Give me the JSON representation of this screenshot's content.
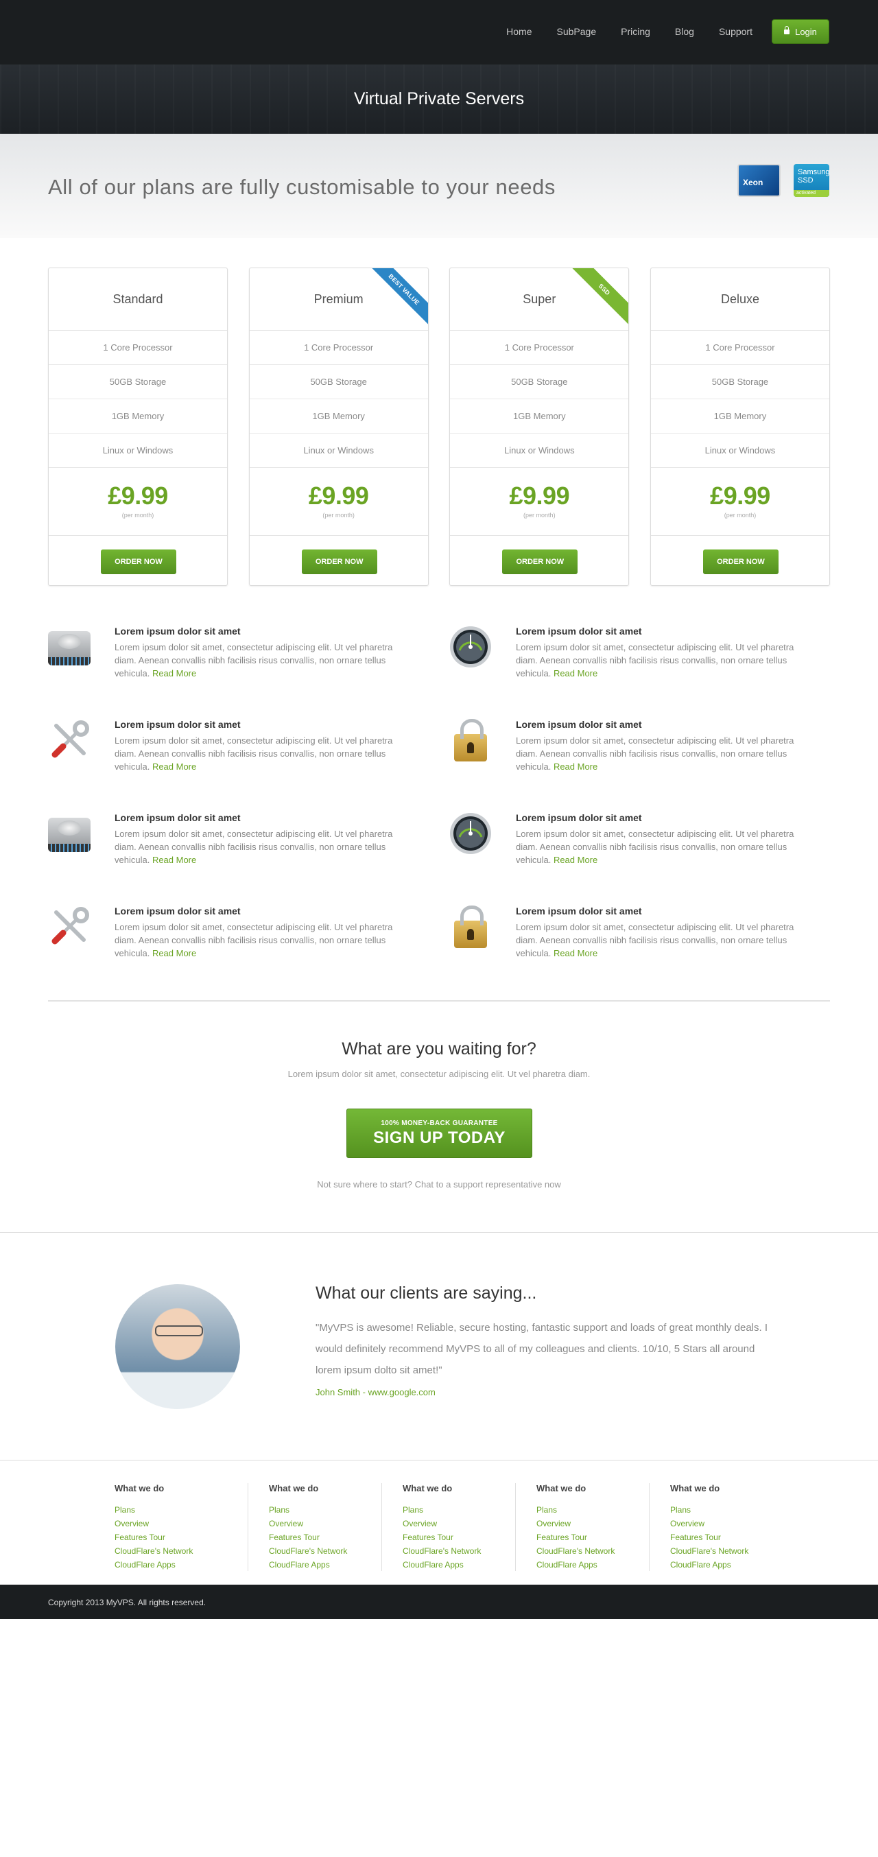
{
  "nav": {
    "items": [
      "Home",
      "SubPage",
      "Pricing",
      "Blog",
      "Support"
    ],
    "login_label": "Login"
  },
  "hero": {
    "title": "Virtual Private Servers"
  },
  "tagline": {
    "text": "All of our plans are fully customisable to your needs",
    "badge_intel": "Xeon",
    "badge_ssd": "Samsung SSD",
    "badge_ssd_sub": "activated"
  },
  "plans": [
    {
      "name": "Standard",
      "ribbon": "",
      "features": [
        "1 Core Processor",
        "50GB Storage",
        "1GB Memory",
        "Linux or Windows"
      ],
      "price": "£9.99",
      "period": "(per month)",
      "cta": "ORDER NOW"
    },
    {
      "name": "Premium",
      "ribbon": "BEST VALUE",
      "features": [
        "1 Core Processor",
        "50GB Storage",
        "1GB Memory",
        "Linux or Windows"
      ],
      "price": "£9.99",
      "period": "(per month)",
      "cta": "ORDER NOW"
    },
    {
      "name": "Super",
      "ribbon": "SSD",
      "features": [
        "1 Core Processor",
        "50GB Storage",
        "1GB Memory",
        "Linux or Windows"
      ],
      "price": "£9.99",
      "period": "(per month)",
      "cta": "ORDER NOW"
    },
    {
      "name": "Deluxe",
      "ribbon": "",
      "features": [
        "1 Core Processor",
        "50GB Storage",
        "1GB Memory",
        "Linux or Windows"
      ],
      "price": "£9.99",
      "period": "(per month)",
      "cta": "ORDER NOW"
    }
  ],
  "features": [
    {
      "icon": "hard-drive-icon",
      "title": "Lorem ipsum dolor sit amet",
      "body": "Lorem ipsum dolor sit amet, consectetur adipiscing elit. Ut vel pharetra diam. Aenean convallis nibh facilisis risus convallis, non ornare tellus vehicula.",
      "link": "Read More"
    },
    {
      "icon": "gauge-icon",
      "title": "Lorem ipsum dolor sit amet",
      "body": "Lorem ipsum dolor sit amet, consectetur adipiscing elit. Ut vel pharetra diam. Aenean convallis nibh facilisis risus convallis, non ornare tellus vehicula.",
      "link": "Read More"
    },
    {
      "icon": "tools-icon",
      "title": "Lorem ipsum dolor sit amet",
      "body": "Lorem ipsum dolor sit amet, consectetur adipiscing elit. Ut vel pharetra diam. Aenean convallis nibh facilisis risus convallis, non ornare tellus vehicula.",
      "link": "Read More"
    },
    {
      "icon": "padlock-icon",
      "title": "Lorem ipsum dolor sit amet",
      "body": "Lorem ipsum dolor sit amet, consectetur adipiscing elit. Ut vel pharetra diam. Aenean convallis nibh facilisis risus convallis, non ornare tellus vehicula.",
      "link": "Read More"
    },
    {
      "icon": "hard-drive-icon",
      "title": "Lorem ipsum dolor sit amet",
      "body": "Lorem ipsum dolor sit amet, consectetur adipiscing elit. Ut vel pharetra diam. Aenean convallis nibh facilisis risus convallis, non ornare tellus vehicula.",
      "link": "Read More"
    },
    {
      "icon": "gauge-icon",
      "title": "Lorem ipsum dolor sit amet",
      "body": "Lorem ipsum dolor sit amet, consectetur adipiscing elit. Ut vel pharetra diam. Aenean convallis nibh facilisis risus convallis, non ornare tellus vehicula.",
      "link": "Read More"
    },
    {
      "icon": "tools-icon",
      "title": "Lorem ipsum dolor sit amet",
      "body": "Lorem ipsum dolor sit amet, consectetur adipiscing elit. Ut vel pharetra diam. Aenean convallis nibh facilisis risus convallis, non ornare tellus vehicula.",
      "link": "Read More"
    },
    {
      "icon": "padlock-icon",
      "title": "Lorem ipsum dolor sit amet",
      "body": "Lorem ipsum dolor sit amet, consectetur adipiscing elit. Ut vel pharetra diam. Aenean convallis nibh facilisis risus convallis, non ornare tellus vehicula.",
      "link": "Read More"
    }
  ],
  "cta": {
    "title": "What are you waiting for?",
    "subtitle": "Lorem ipsum dolor sit amet, consectetur adipiscing elit. Ut vel pharetra diam.",
    "button_kicker": "100% MONEY-BACK GUARANTEE",
    "button_label": "SIGN UP TODAY",
    "help": "Not sure where to start? Chat to a support representative now"
  },
  "testimonial": {
    "title": "What our clients are saying...",
    "quote": "\"MyVPS is awesome! Reliable, secure hosting, fantastic support and loads of great monthly deals. I would definitely recommend MyVPS to all of my colleagues and clients. 10/10, 5 Stars all around lorem ipsum dolto sit amet!\"",
    "author": "John Smith - www.google.com"
  },
  "footer": {
    "columns": [
      {
        "title": "What we do",
        "links": [
          "Plans",
          "Overview",
          "Features Tour",
          "CloudFlare's Network",
          "CloudFlare Apps"
        ]
      },
      {
        "title": "What we do",
        "links": [
          "Plans",
          "Overview",
          "Features Tour",
          "CloudFlare's Network",
          "CloudFlare Apps"
        ]
      },
      {
        "title": "What we do",
        "links": [
          "Plans",
          "Overview",
          "Features Tour",
          "CloudFlare's Network",
          "CloudFlare Apps"
        ]
      },
      {
        "title": "What we do",
        "links": [
          "Plans",
          "Overview",
          "Features Tour",
          "CloudFlare's Network",
          "CloudFlare Apps"
        ]
      },
      {
        "title": "What we do",
        "links": [
          "Plans",
          "Overview",
          "Features Tour",
          "CloudFlare's Network",
          "CloudFlare Apps"
        ]
      }
    ],
    "copyright": "Copyright 2013 MyVPS. All rights reserved."
  },
  "colors": {
    "accent": "#6aa424",
    "dark": "#1b1e20",
    "ribbon_blue": "#2b86c6"
  }
}
